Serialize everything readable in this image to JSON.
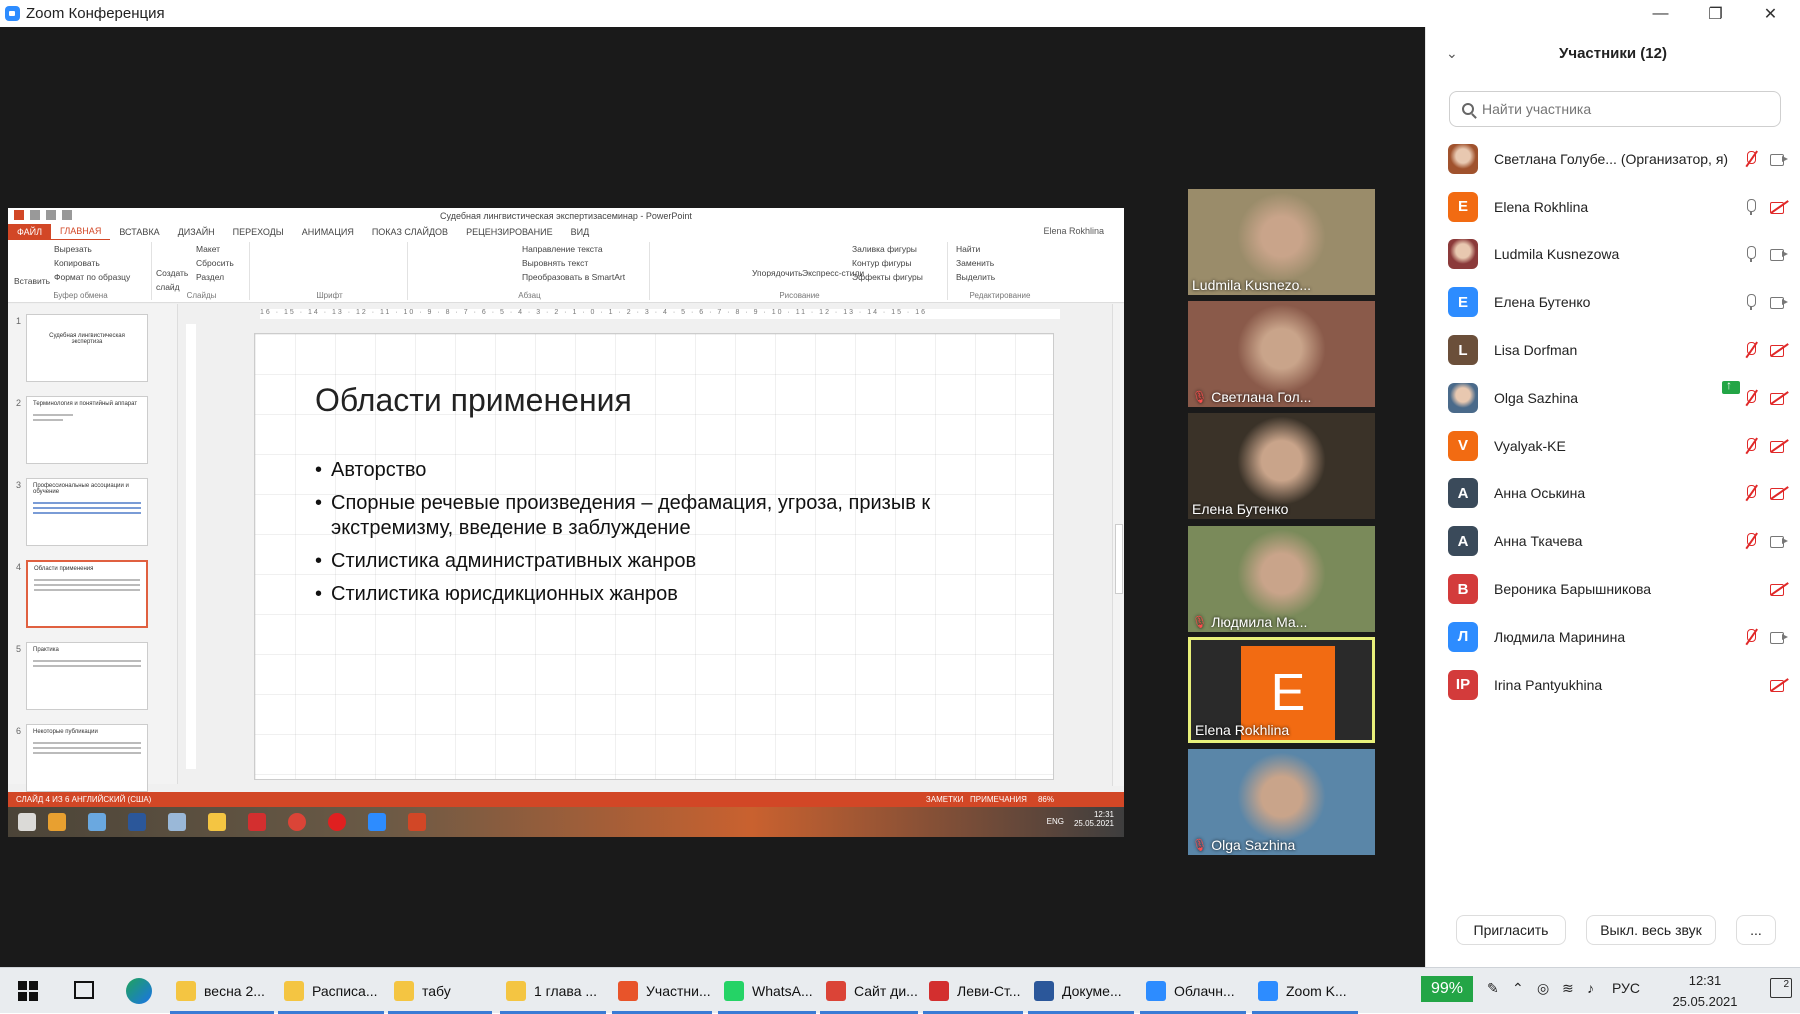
{
  "window": {
    "title": "Zoom Конференция",
    "min": "—",
    "max": "❐",
    "close": "✕"
  },
  "ppt": {
    "title": "Судебная лингвистическая экспертизасеминар - PowerPoint",
    "tabs": [
      "ФАЙЛ",
      "ГЛАВНАЯ",
      "ВСТАВКА",
      "ДИЗАЙН",
      "ПЕРЕХОДЫ",
      "АНИМАЦИЯ",
      "ПОКАЗ СЛАЙДОВ",
      "РЕЦЕНЗИРОВАНИЕ",
      "ВИД"
    ],
    "user": "Elena Rokhlina",
    "ribbon": {
      "clipboard": {
        "label": "Буфер обмена",
        "paste": "Вставить",
        "cut": "Вырезать",
        "copy": "Копировать",
        "format": "Формат по образцу"
      },
      "slides": {
        "label": "Слайды",
        "create": "Создать слайд",
        "layout": "Макет",
        "reset": "Сбросить",
        "section": "Раздел"
      },
      "font": {
        "label": "Шрифт"
      },
      "paragraph": {
        "label": "Абзац",
        "dir": "Направление текста",
        "align": "Выровнять текст",
        "smartart": "Преобразовать в SmartArt"
      },
      "drawing": {
        "label": "Рисование",
        "arrange": "Упорядочить",
        "styles": "Экспресс-стили",
        "fill": "Заливка фигуры",
        "outline": "Контур фигуры",
        "effects": "Эффекты фигуры"
      },
      "editing": {
        "label": "Редактирование",
        "find": "Найти",
        "replace": "Заменить",
        "select": "Выделить"
      }
    },
    "ruler": "16 · 15 · 14 · 13 · 12 · 11 · 10 · 9 · 8 · 7 · 6 · 5 · 4 · 3 · 2 · 1 · 0 · 1 · 2 · 3 · 4 · 5 · 6 · 7 · 8 · 9 · 10 · 11 · 12 · 13 · 14 · 15 · 16",
    "thumbs": [
      {
        "num": "1",
        "title": "Судебная лингвистическая экспертиза"
      },
      {
        "num": "2",
        "title": "Терминология и понятийный аппарат"
      },
      {
        "num": "3",
        "title": "Профессиональные ассоциации и обучение"
      },
      {
        "num": "4",
        "title": "Области применения"
      },
      {
        "num": "5",
        "title": "Практика"
      },
      {
        "num": "6",
        "title": "Некоторые публикации"
      }
    ],
    "slide": {
      "title": "Области применения",
      "bullets": [
        "Авторство",
        "Спорные речевые произведения – дефамация, угроза, призыв к экстремизму, введение в заблуждение",
        "Стилистика административных жанров",
        "Стилистика юрисдикционных жанров"
      ]
    },
    "status": {
      "left": "СЛАЙД 4 ИЗ 6    АНГЛИЙСКИЙ (США)",
      "notes": "ЗАМЕТКИ",
      "comments": "ПРИМЕЧАНИЯ",
      "zoom": "86%"
    },
    "clock_time": "12:31",
    "clock_date": "25.05.2021",
    "lang": "ENG"
  },
  "videos": [
    {
      "name": "Ludmila Kusnezo...",
      "muted": false,
      "bg": "#9a8c6a"
    },
    {
      "name": "Светлана Гол...",
      "muted": true,
      "bg": "#8a5a4a"
    },
    {
      "name": "Елена Бутенко",
      "muted": false,
      "bg": "#3a3228"
    },
    {
      "name": "Людмила Ма...",
      "muted": true,
      "bg": "#7a8a5a"
    },
    {
      "name": "Elena Rokhlina",
      "muted": false,
      "avatar": "E",
      "active": true
    },
    {
      "name": "Olga Sazhina",
      "muted": true,
      "bg": "#5a86a8"
    }
  ],
  "panel": {
    "title": "Участники (12)",
    "search_placeholder": "Найти участника",
    "participants": [
      {
        "name": "Светлана Голубе... (Организатор, я)",
        "avatar": "",
        "color": "#a0522d",
        "mic": "off",
        "cam": "on",
        "share": false
      },
      {
        "name": "Elena Rokhlina",
        "avatar": "E",
        "color": "#f26b12",
        "mic": "on",
        "cam": "off",
        "share": true
      },
      {
        "name": "Ludmila Kusnezowa",
        "avatar": "",
        "color": "#8b3a3a",
        "mic": "on",
        "cam": "on",
        "share": false
      },
      {
        "name": "Елена Бутенко",
        "avatar": "Е",
        "color": "#2d8cff",
        "mic": "on",
        "cam": "on",
        "share": false
      },
      {
        "name": "Lisa Dorfman",
        "avatar": "L",
        "color": "#6b4f3a",
        "mic": "off",
        "cam": "off",
        "share": false
      },
      {
        "name": "Olga Sazhina",
        "avatar": "",
        "color": "#4a6a8a",
        "mic": "off",
        "cam": "off",
        "share": false
      },
      {
        "name": "Vyalyak-KE",
        "avatar": "V",
        "color": "#f26b12",
        "mic": "off",
        "cam": "off",
        "share": false
      },
      {
        "name": "Анна Оськина",
        "avatar": "А",
        "color": "#3a4a5a",
        "mic": "off",
        "cam": "off",
        "share": false
      },
      {
        "name": "Анна Ткачева",
        "avatar": "А",
        "color": "#3a4a5a",
        "mic": "off",
        "cam": "on",
        "share": false
      },
      {
        "name": "Вероника Барышникова",
        "avatar": "В",
        "color": "#d33b3b",
        "mic": "none",
        "cam": "off",
        "share": false
      },
      {
        "name": "Людмила Маринина",
        "avatar": "Л",
        "color": "#2d8cff",
        "mic": "off",
        "cam": "on",
        "share": false
      },
      {
        "name": "Irina Pantyukhina",
        "avatar": "IP",
        "color": "#d33b3b",
        "mic": "none",
        "cam": "off",
        "share": false
      }
    ],
    "invite": "Пригласить",
    "mute_all": "Выкл. весь звук",
    "more": "..."
  },
  "taskbar": {
    "apps": [
      {
        "label": "весна 2...",
        "color": "#f4c542"
      },
      {
        "label": "Расписа...",
        "color": "#f4c542"
      },
      {
        "label": "табу",
        "color": "#f4c542"
      },
      {
        "label": "1 глава ...",
        "color": "#f4c542"
      },
      {
        "label": "Участни...",
        "color": "#e8542a"
      },
      {
        "label": "WhatsA...",
        "color": "#25d366"
      },
      {
        "label": "Сайт ди...",
        "color": "#db4437"
      },
      {
        "label": "Леви-Ст...",
        "color": "#d32f2f"
      },
      {
        "label": "Докуме...",
        "color": "#2b579a"
      },
      {
        "label": "Облачн...",
        "color": "#2d8cff"
      },
      {
        "label": "Zoom K...",
        "color": "#2d8cff"
      }
    ],
    "battery": "99%",
    "lang": "РУС",
    "time": "12:31",
    "date": "25.05.2021",
    "notifications": "2"
  }
}
